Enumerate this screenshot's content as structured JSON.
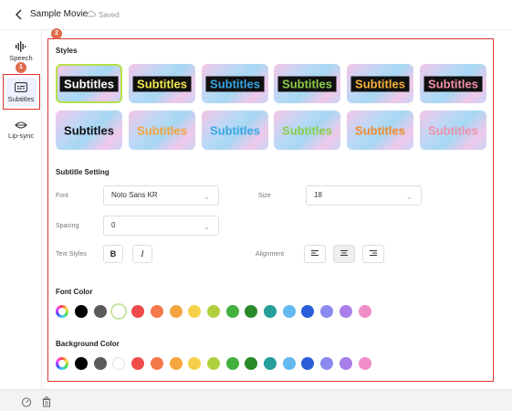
{
  "header": {
    "title": "Sample Movie",
    "saved_text": "Saved"
  },
  "sidebar": {
    "items": [
      {
        "label": "Speech",
        "icon": "speech-wave-icon"
      },
      {
        "label": "Subtitles",
        "icon": "subtitles-icon",
        "selected": true
      },
      {
        "label": "Lip-sync",
        "icon": "lip-icon"
      }
    ]
  },
  "annotations": {
    "step1": "1",
    "step2": "2"
  },
  "styles": {
    "title": "Styles",
    "items": [
      {
        "text": "Subtitles",
        "color": "#ffffff",
        "bg": "#111111",
        "selected": true
      },
      {
        "text": "Subtitles",
        "color": "#f2e94e",
        "bg": "#111111"
      },
      {
        "text": "Subtitles",
        "color": "#3aa3e3",
        "bg": "#111111"
      },
      {
        "text": "Subtitles",
        "color": "#8ccc4a",
        "bg": "#111111"
      },
      {
        "text": "Subtitles",
        "color": "#f4b23a",
        "bg": "#111111"
      },
      {
        "text": "Subtitles",
        "color": "#f08fa8",
        "bg": "#111111"
      },
      {
        "text": "Subtitles",
        "color": "#111111",
        "bg": "#ffffff"
      },
      {
        "text": "Subtitles",
        "color": "#f4a23a",
        "bg": "#ffffff"
      },
      {
        "text": "Subtitles",
        "color": "#3aa6e3",
        "bg": "#ffffff"
      },
      {
        "text": "Subtitles",
        "color": "#8ccc4a",
        "bg": "#ffffff"
      },
      {
        "text": "Subtitles",
        "color": "#f08a2a",
        "bg": "#ffffff"
      },
      {
        "text": "Subtitles",
        "color": "#f08fa8",
        "bg": "#ffffff"
      }
    ]
  },
  "subtitle_setting": {
    "title": "Subtitle Setting",
    "font_label": "Font",
    "font_value": "Noto Sans KR",
    "size_label": "Size",
    "size_value": "18",
    "spacing_label": "Spacing",
    "spacing_value": "0",
    "text_styles_label": "Text Styles",
    "bold_label": "B",
    "italic_label": "I",
    "alignment_label": "Alignment"
  },
  "font_color": {
    "title": "Font Color",
    "swatches": [
      "#000000",
      "#5a5a5a",
      "#ffffff",
      "#ef4b4b",
      "#f5784a",
      "#f5a540",
      "#f5d04a",
      "#b0d040",
      "#44b040",
      "#2a8a2a",
      "#269e9a",
      "#62baf0",
      "#2a5ed8",
      "#8a8af0",
      "#a87ee8",
      "#f08cc8"
    ],
    "selected_index": 2
  },
  "background_color": {
    "title": "Background Color",
    "swatches": [
      "#000000",
      "#5a5a5a",
      "#ffffff",
      "#ef4b4b",
      "#f5784a",
      "#f5a540",
      "#f5d04a",
      "#b0d040",
      "#44b040",
      "#2a8a2a",
      "#269e9a",
      "#62baf0",
      "#2a5ed8",
      "#8a8af0",
      "#a87ee8",
      "#f08cc8"
    ]
  }
}
